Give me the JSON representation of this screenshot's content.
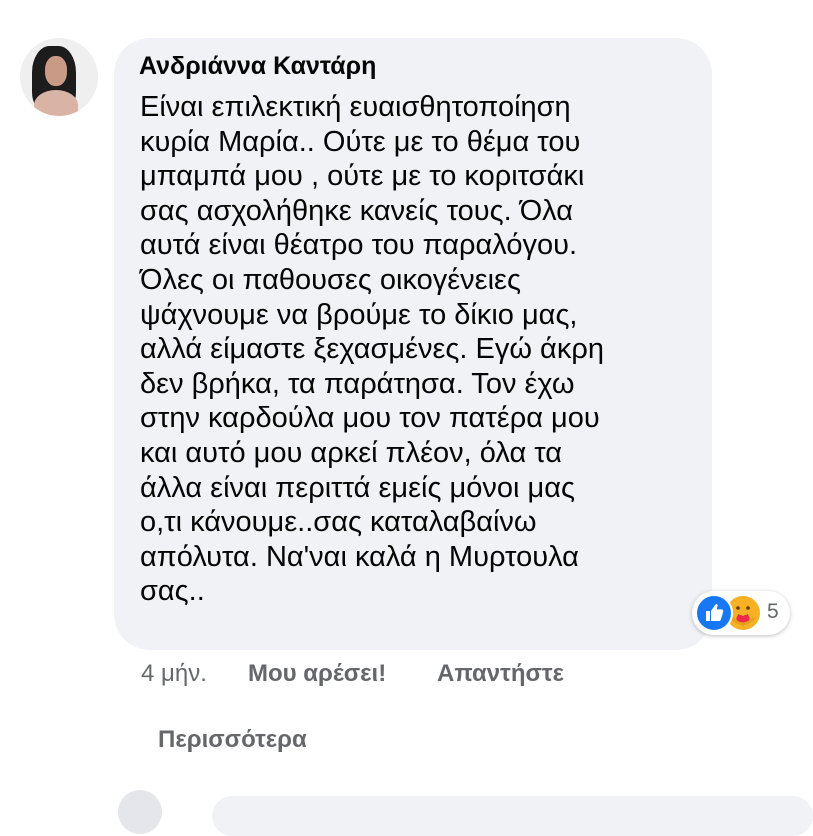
{
  "comment": {
    "author": "Ανδριάννα Καντάρη",
    "text_lines": [
      "Είναι επιλεκτική ευαισθητοποίηση",
      "κυρία Μαρία.. Ούτε με το θέμα του",
      "μπαμπά μου , ούτε με το κοριτσάκι",
      "σας ασχολήθηκε κανείς τους. Όλα",
      "αυτά είναι θέατρο του παραλόγου.",
      "Όλες οι παθουσες οικογένειες",
      "ψάχνουμε να βρούμε το δίκιο μας,",
      "αλλά είμαστε ξεχασμένες. Εγώ άκρη",
      "δεν βρήκα, τα παράτησα. Τον έχω",
      "στην καρδούλα μου τον πατέρα μου",
      "και αυτό μου αρκεί πλέον, όλα τα",
      "άλλα είναι περιττά εμείς μόνοι μας",
      "ο,τι κάνουμε..σας καταλαβαίνω",
      "απόλυτα. Να'ναι καλά η Μυρτουλα",
      "σας.."
    ],
    "reactions": {
      "icons": [
        "like-icon",
        "care-icon"
      ],
      "count": "5"
    },
    "time": "4 μήν.",
    "like_label": "Μου αρέσει!",
    "reply_label": "Απαντήστε"
  },
  "more_label": "Περισσότερα",
  "colors": {
    "bubble": "#f0f2f5",
    "meta_text": "#65676b",
    "like_blue": "#1877f2",
    "care_yellow": "#f7b125"
  }
}
